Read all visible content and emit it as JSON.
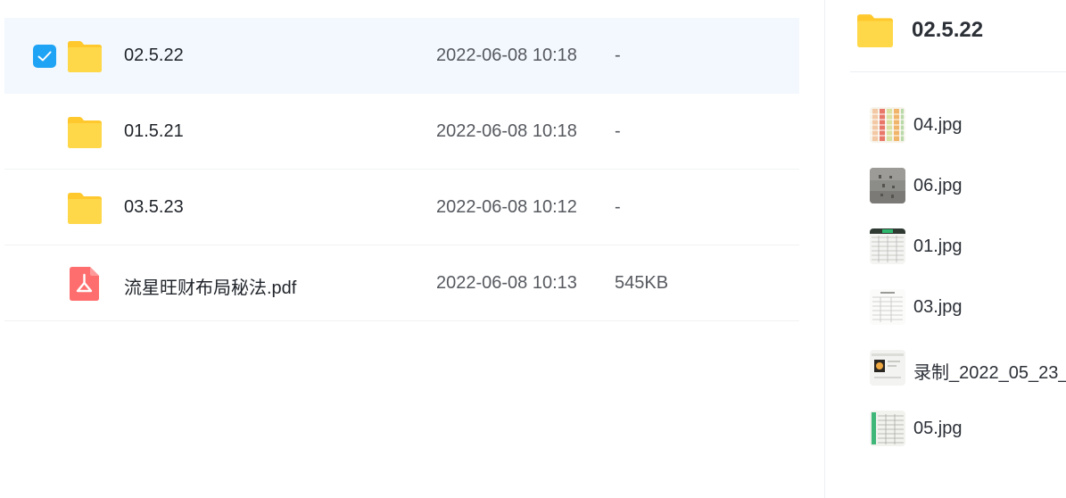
{
  "file_list": {
    "rows": [
      {
        "name": "02.5.22",
        "date": "2022-06-08 10:18",
        "size": "-",
        "type": "folder",
        "selected": true
      },
      {
        "name": "01.5.21",
        "date": "2022-06-08 10:18",
        "size": "-",
        "type": "folder",
        "selected": false
      },
      {
        "name": "03.5.23",
        "date": "2022-06-08 10:12",
        "size": "-",
        "type": "folder",
        "selected": false
      },
      {
        "name": "流星旺财布局秘法.pdf",
        "date": "2022-06-08 10:13",
        "size": "545KB",
        "type": "pdf",
        "selected": false
      }
    ]
  },
  "preview_panel": {
    "title": "02.5.22",
    "files": [
      {
        "name": "04.jpg",
        "thumb": "color-table"
      },
      {
        "name": "06.jpg",
        "thumb": "gray-photo"
      },
      {
        "name": "01.jpg",
        "thumb": "grid-green-header"
      },
      {
        "name": "03.jpg",
        "thumb": "doc-table"
      },
      {
        "name": "录制_2022_05_23_",
        "thumb": "video-frame"
      },
      {
        "name": "05.jpg",
        "thumb": "grid-green-side"
      }
    ]
  },
  "colors": {
    "accent": "#1fa3f5",
    "folder": "#ffd53f",
    "pdf": "#ff6b6b",
    "selected_row": "#f2f8fe"
  }
}
